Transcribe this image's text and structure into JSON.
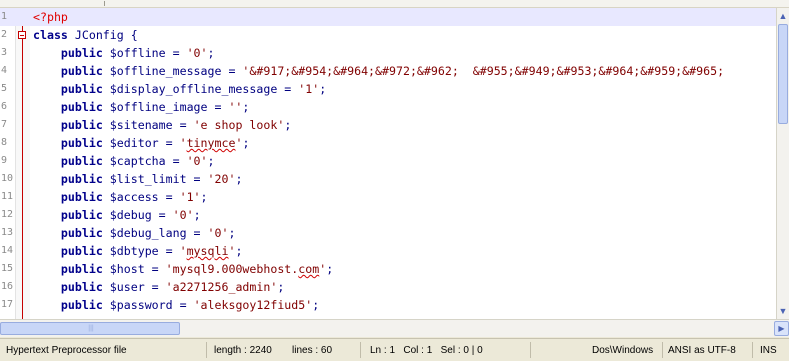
{
  "editor": {
    "lines": [
      {
        "n": "1",
        "code": [
          {
            "c": "php-tag",
            "t": "<?php"
          }
        ]
      },
      {
        "n": "2",
        "code": [
          {
            "c": "kw",
            "t": "class"
          },
          {
            "c": "plain",
            "t": " JConfig {"
          }
        ]
      },
      {
        "n": "3",
        "code": [
          {
            "c": "plain",
            "t": "    "
          },
          {
            "c": "kw",
            "t": "public"
          },
          {
            "c": "var",
            "t": " $offline = "
          },
          {
            "c": "str",
            "t": "'0'"
          },
          {
            "c": "plain",
            "t": ";"
          }
        ]
      },
      {
        "n": "4",
        "code": [
          {
            "c": "plain",
            "t": "    "
          },
          {
            "c": "kw",
            "t": "public"
          },
          {
            "c": "var",
            "t": " $offline_message = "
          },
          {
            "c": "str",
            "t": "'&#917;&#954;&#964;&#972;&#962;  &#955;&#949;&#953;&#964;&#959;&#965;"
          }
        ]
      },
      {
        "n": "5",
        "code": [
          {
            "c": "plain",
            "t": "    "
          },
          {
            "c": "kw",
            "t": "public"
          },
          {
            "c": "var",
            "t": " $display_offline_message = "
          },
          {
            "c": "str",
            "t": "'1'"
          },
          {
            "c": "plain",
            "t": ";"
          }
        ]
      },
      {
        "n": "6",
        "code": [
          {
            "c": "plain",
            "t": "    "
          },
          {
            "c": "kw",
            "t": "public"
          },
          {
            "c": "var",
            "t": " $offline_image = "
          },
          {
            "c": "str",
            "t": "''"
          },
          {
            "c": "plain",
            "t": ";"
          }
        ]
      },
      {
        "n": "7",
        "code": [
          {
            "c": "plain",
            "t": "    "
          },
          {
            "c": "kw",
            "t": "public"
          },
          {
            "c": "var",
            "t": " $sitename = "
          },
          {
            "c": "str",
            "t": "'e shop look'"
          },
          {
            "c": "plain",
            "t": ";"
          }
        ]
      },
      {
        "n": "8",
        "code": [
          {
            "c": "plain",
            "t": "    "
          },
          {
            "c": "kw",
            "t": "public"
          },
          {
            "c": "var",
            "t": " $editor = "
          },
          {
            "c": "str",
            "t": "'"
          },
          {
            "c": "str sq",
            "t": "tinymce"
          },
          {
            "c": "str",
            "t": "'"
          },
          {
            "c": "plain",
            "t": ";"
          }
        ]
      },
      {
        "n": "9",
        "code": [
          {
            "c": "plain",
            "t": "    "
          },
          {
            "c": "kw",
            "t": "public"
          },
          {
            "c": "var",
            "t": " $captcha = "
          },
          {
            "c": "str",
            "t": "'0'"
          },
          {
            "c": "plain",
            "t": ";"
          }
        ]
      },
      {
        "n": "10",
        "code": [
          {
            "c": "plain",
            "t": "    "
          },
          {
            "c": "kw",
            "t": "public"
          },
          {
            "c": "var",
            "t": " $list_limit = "
          },
          {
            "c": "str",
            "t": "'20'"
          },
          {
            "c": "plain",
            "t": ";"
          }
        ]
      },
      {
        "n": "11",
        "code": [
          {
            "c": "plain",
            "t": "    "
          },
          {
            "c": "kw",
            "t": "public"
          },
          {
            "c": "var",
            "t": " $access = "
          },
          {
            "c": "str",
            "t": "'1'"
          },
          {
            "c": "plain",
            "t": ";"
          }
        ]
      },
      {
        "n": "12",
        "code": [
          {
            "c": "plain",
            "t": "    "
          },
          {
            "c": "kw",
            "t": "public"
          },
          {
            "c": "var",
            "t": " $debug = "
          },
          {
            "c": "str",
            "t": "'0'"
          },
          {
            "c": "plain",
            "t": ";"
          }
        ]
      },
      {
        "n": "13",
        "code": [
          {
            "c": "plain",
            "t": "    "
          },
          {
            "c": "kw",
            "t": "public"
          },
          {
            "c": "var",
            "t": " $debug_lang = "
          },
          {
            "c": "str",
            "t": "'0'"
          },
          {
            "c": "plain",
            "t": ";"
          }
        ]
      },
      {
        "n": "14",
        "code": [
          {
            "c": "plain",
            "t": "    "
          },
          {
            "c": "kw",
            "t": "public"
          },
          {
            "c": "var",
            "t": " $dbtype = "
          },
          {
            "c": "str",
            "t": "'"
          },
          {
            "c": "str sq",
            "t": "mysqli"
          },
          {
            "c": "str",
            "t": "'"
          },
          {
            "c": "plain",
            "t": ";"
          }
        ]
      },
      {
        "n": "15",
        "code": [
          {
            "c": "plain",
            "t": "    "
          },
          {
            "c": "kw",
            "t": "public"
          },
          {
            "c": "var",
            "t": " $host = "
          },
          {
            "c": "str",
            "t": "'mysql9.000webhost."
          },
          {
            "c": "str sq",
            "t": "com"
          },
          {
            "c": "str",
            "t": "'"
          },
          {
            "c": "plain",
            "t": ";"
          }
        ]
      },
      {
        "n": "16",
        "code": [
          {
            "c": "plain",
            "t": "    "
          },
          {
            "c": "kw",
            "t": "public"
          },
          {
            "c": "var",
            "t": " $user = "
          },
          {
            "c": "str",
            "t": "'a2271256_admin'"
          },
          {
            "c": "plain",
            "t": ";"
          }
        ]
      },
      {
        "n": "17",
        "code": [
          {
            "c": "plain",
            "t": "    "
          },
          {
            "c": "kw",
            "t": "public"
          },
          {
            "c": "var",
            "t": " $password = "
          },
          {
            "c": "str",
            "t": "'aleksgoy12fiud5'"
          },
          {
            "c": "plain",
            "t": ";"
          }
        ]
      }
    ]
  },
  "status": {
    "file_type": "Hypertext Preprocessor file",
    "length": "length : 2240",
    "lines": "lines : 60",
    "position": "Ln : 1   Col : 1   Sel : 0 | 0",
    "eol": "Dos\\Windows",
    "encoding": "ANSI as UTF-8",
    "mode": "INS"
  },
  "colors": {
    "keyword": "#00008b",
    "string": "#800000",
    "php_tag": "#e00000",
    "current_line": "#e8e8ff",
    "fold_marker": "#c60000"
  },
  "icons": {
    "scroll_up": "arrow-up-icon",
    "scroll_down": "arrow-down-icon",
    "scroll_right": "arrow-right-icon"
  }
}
